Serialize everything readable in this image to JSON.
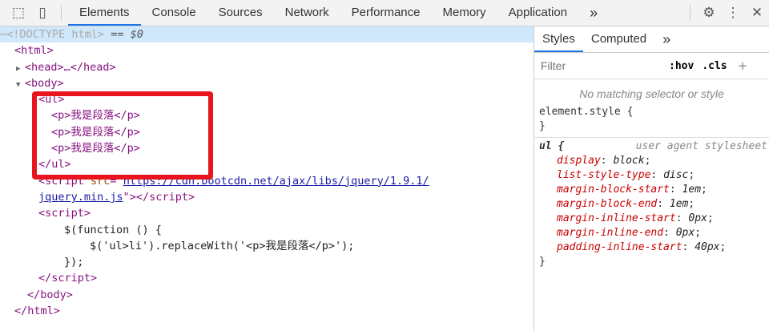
{
  "toolbar": {
    "tabs": [
      "Elements",
      "Console",
      "Sources",
      "Network",
      "Performance",
      "Memory",
      "Application"
    ],
    "more": "»"
  },
  "dom": {
    "doctype": "<!DOCTYPE html>",
    "doctype_suffix": " == $0",
    "lines": [
      "<html>",
      "<head>…</head>",
      "<body>",
      "<ul>",
      "<p>我是段落</p>",
      "<p>我是段落</p>",
      "<p>我是段落</p>",
      "</ul>"
    ],
    "script_open": "<script ",
    "src_attr": "src",
    "src_val": "https://cdn.bootcdn.net/ajax/libs/jquery/1.9.1/",
    "src_val2": "jquery.min.js",
    "script_close_tail": "\"></script>",
    "script2": "<script>",
    "code1": "$(function () {",
    "code2": "$('ul>li').replaceWith('<p>我是段落</p>');",
    "code3": "});",
    "script_end": "</script>",
    "body_end": "</body>",
    "html_end": "</html>"
  },
  "styles": {
    "tabs": [
      "Styles",
      "Computed"
    ],
    "more": "»",
    "filter_placeholder": "Filter",
    "hov": ":hov",
    "cls": ".cls",
    "add": "+",
    "no_match": "No matching selector or style",
    "element_style": "element.style {",
    "close": "}",
    "ua_selector": "ul {",
    "ua_source": "user agent stylesheet",
    "props": [
      [
        "display",
        "block"
      ],
      [
        "list-style-type",
        "disc"
      ],
      [
        "margin-block-start",
        "1em"
      ],
      [
        "margin-block-end",
        "1em"
      ],
      [
        "margin-inline-start",
        "0px"
      ],
      [
        "margin-inline-end",
        "0px"
      ],
      [
        "padding-inline-start",
        "40px"
      ]
    ]
  }
}
